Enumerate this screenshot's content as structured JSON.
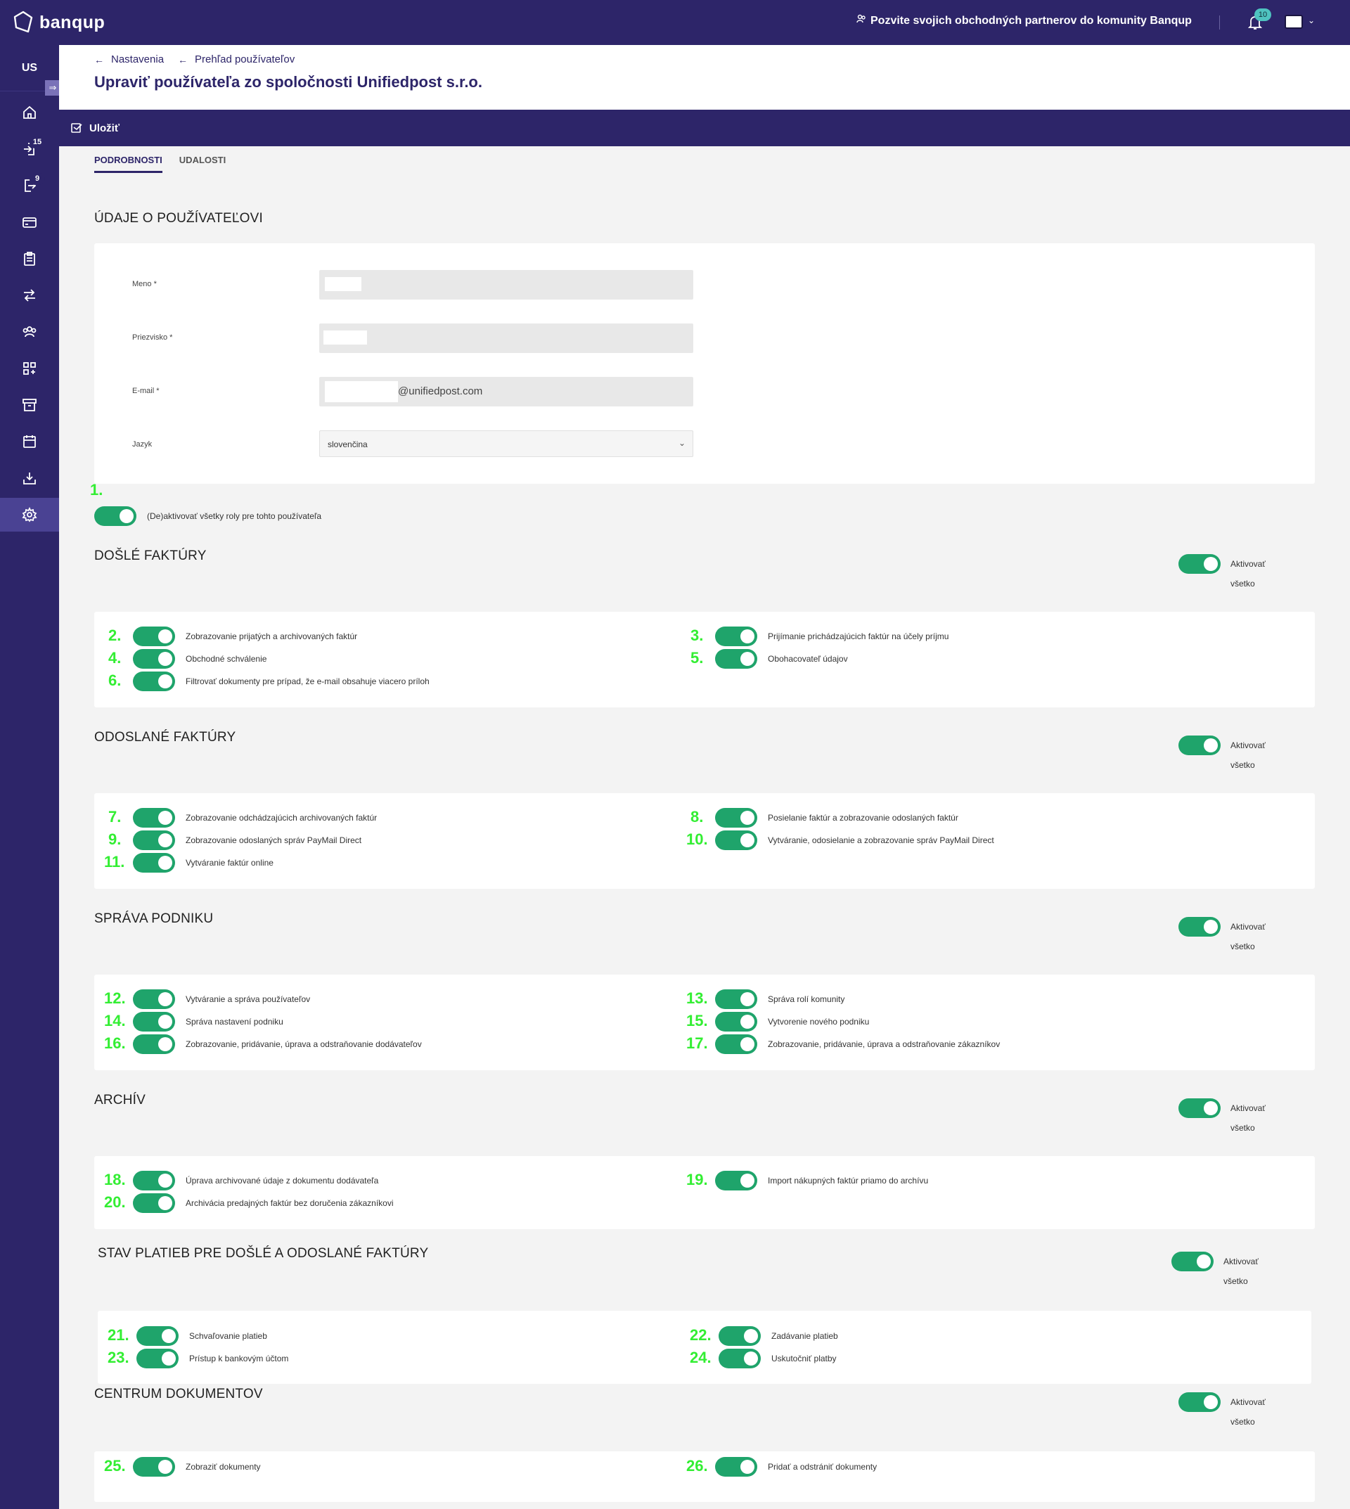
{
  "app": {
    "brand": "banqup",
    "invite_text": "Pozvite svojich obchodných partnerov do komunity Banqup",
    "notification_count": "10",
    "company_code": "US",
    "accent": "#2d2569",
    "toggle_color": "#1fa46b"
  },
  "sidebar": {
    "expand_glyph": "⇒",
    "items": [
      {
        "icon": "home-icon"
      },
      {
        "icon": "incoming-icon",
        "badge": "15"
      },
      {
        "icon": "outgoing-icon",
        "badge": "9"
      },
      {
        "icon": "card-icon"
      },
      {
        "icon": "clipboard-icon"
      },
      {
        "icon": "transfer-icon"
      },
      {
        "icon": "community-icon"
      },
      {
        "icon": "apps-icon"
      },
      {
        "icon": "archive-icon"
      },
      {
        "icon": "calendar-icon"
      },
      {
        "icon": "download-icon"
      },
      {
        "icon": "gear-icon",
        "active": true
      }
    ]
  },
  "breadcrumb": [
    "Nastavenia",
    "Prehľad používateľov"
  ],
  "page_title": "Upraviť používateľa zo spoločnosti Unifiedpost s.r.o.",
  "actions": {
    "save_label": "Uložiť"
  },
  "tabs": [
    "PODROBNOSTI",
    "UDALOSTI"
  ],
  "user_section": {
    "title": "ÚDAJE O POUŽÍVATEĽOVI",
    "fields": {
      "first_name_label": "Meno *",
      "last_name_label": "Priezvisko *",
      "email_label": "E-mail *",
      "email_domain": "@unifiedpost.com",
      "language_label": "Jazyk",
      "language_value": "slovenčina"
    }
  },
  "master_toggle": {
    "num": "1.",
    "label": "(De)aktivovať všetky roly pre tohto používateľa"
  },
  "activate_all": [
    "Aktivovať",
    "všetko"
  ],
  "sections": [
    {
      "title": "DOŠLÉ FAKTÚRY",
      "left": [
        {
          "num": "2.",
          "label": "Zobrazovanie prijatých a archivovaných faktúr"
        },
        {
          "num": "4.",
          "label": "Obchodné schválenie"
        },
        {
          "num": "6.",
          "label": "Filtrovať dokumenty pre prípad, že e-mail obsahuje viacero príloh"
        }
      ],
      "right": [
        {
          "num": "3.",
          "label": "Prijímanie prichádzajúcich faktúr na účely príjmu"
        },
        {
          "num": "5.",
          "label": "Obohacovateľ údajov"
        }
      ]
    },
    {
      "title": "ODOSLANÉ FAKTÚRY",
      "left": [
        {
          "num": "7.",
          "label": "Zobrazovanie odchádzajúcich archivovaných faktúr"
        },
        {
          "num": "9.",
          "label": "Zobrazovanie odoslaných správ PayMail Direct"
        },
        {
          "num": "11.",
          "label": "Vytváranie faktúr online"
        }
      ],
      "right": [
        {
          "num": "8.",
          "label": "Posielanie faktúr a zobrazovanie odoslaných faktúr"
        },
        {
          "num": "10.",
          "label": "Vytváranie, odosielanie a zobrazovanie správ PayMail Direct"
        }
      ]
    },
    {
      "title": "SPRÁVA PODNIKU",
      "left": [
        {
          "num": "12.",
          "label": "Vytváranie a správa používateľov"
        },
        {
          "num": "14.",
          "label": "Správa nastavení podniku"
        },
        {
          "num": "16.",
          "label": "Zobrazovanie, pridávanie, úprava a odstraňovanie dodávateľov"
        }
      ],
      "right": [
        {
          "num": "13.",
          "label": "Správa rolí komunity"
        },
        {
          "num": "15.",
          "label": "Vytvorenie nového podniku"
        },
        {
          "num": "17.",
          "label": "Zobrazovanie, pridávanie, úprava a odstraňovanie zákazníkov"
        }
      ]
    },
    {
      "title": "ARCHÍV",
      "left": [
        {
          "num": "18.",
          "label": "Úprava archivované údaje z dokumentu dodávateľa"
        },
        {
          "num": "20.",
          "label": "Archivácia predajných faktúr bez doručenia zákazníkovi"
        }
      ],
      "right": [
        {
          "num": "19.",
          "label": "Import nákupných faktúr priamo do archívu"
        }
      ]
    },
    {
      "title": "STAV PLATIEB PRE DOŠLÉ A ODOSLANÉ FAKTÚRY",
      "left": [
        {
          "num": "21.",
          "label": "Schvaľovanie platieb"
        },
        {
          "num": "23.",
          "label": "Prístup k bankovým účtom"
        }
      ],
      "right": [
        {
          "num": "22.",
          "label": "Zadávanie platieb"
        },
        {
          "num": "24.",
          "label": "Uskutočniť platby"
        }
      ]
    },
    {
      "title": "CENTRUM DOKUMENTOV",
      "left": [
        {
          "num": "25.",
          "label": "Zobraziť dokumenty"
        }
      ],
      "right": [
        {
          "num": "26.",
          "label": "Pridať a odstrániť dokumenty"
        }
      ]
    }
  ]
}
